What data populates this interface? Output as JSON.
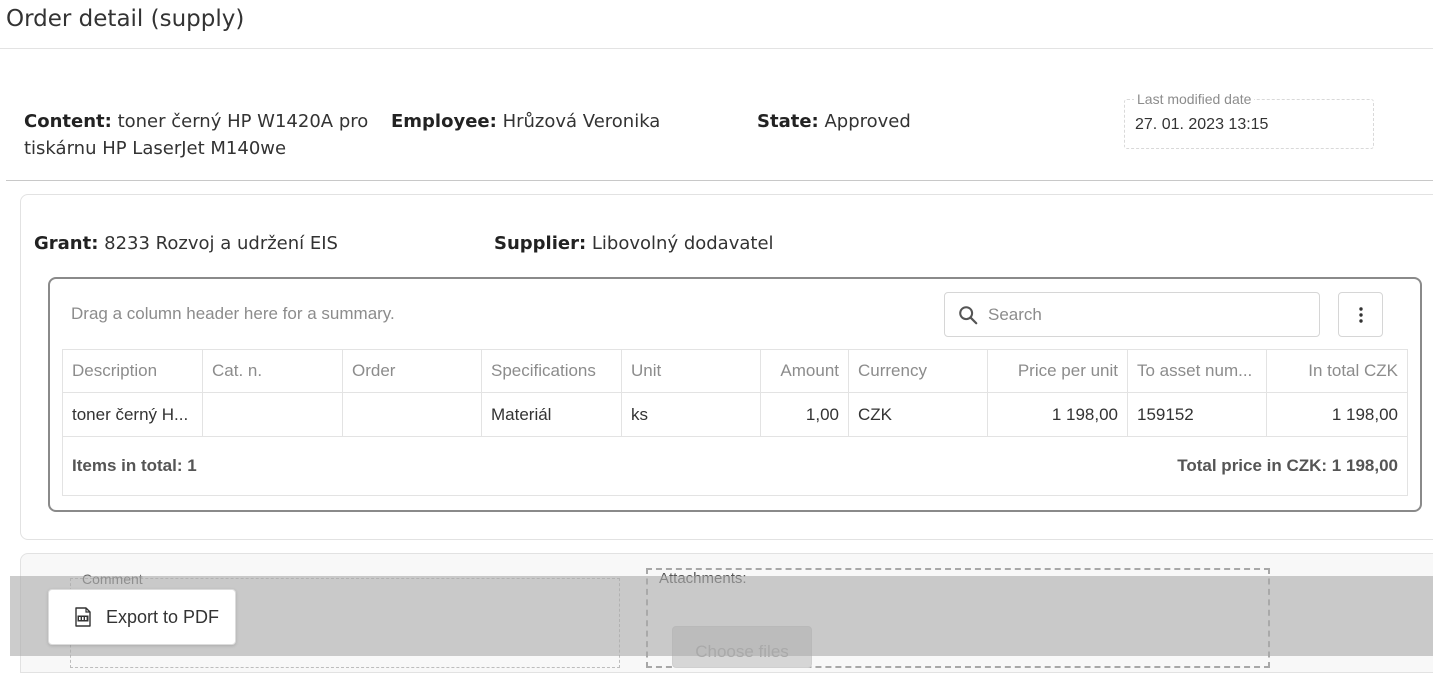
{
  "page": {
    "title": "Order detail (supply)"
  },
  "header": {
    "content_label": "Content:",
    "content_value": "toner černý HP W1420A pro",
    "content_value_2": "tiskárnu HP LaserJet M140we",
    "employee_label": "Employee:",
    "employee_value": "Hrůzová Veronika",
    "state_label": "State:",
    "state_value": "Approved",
    "last_modified_label": "Last modified date",
    "last_modified_value": "27. 01. 2023 13:15"
  },
  "details": {
    "grant_label": "Grant:",
    "grant_value": "8233 Rozvoj a udržení EIS",
    "supplier_label": "Supplier:",
    "supplier_value": "Libovolný dodavatel"
  },
  "grid": {
    "drag_hint": "Drag a column header here for a summary.",
    "search_placeholder": "Search",
    "columns": [
      "Description",
      "Cat. n.",
      "Order",
      "Specifications",
      "Unit",
      "Amount",
      "Currency",
      "Price per unit",
      "To asset num...",
      "In total CZK"
    ],
    "rows": [
      [
        "toner černý H...",
        "",
        "",
        "Materiál",
        "ks",
        "1,00",
        "CZK",
        "1 198,00",
        "159152",
        "1 198,00"
      ]
    ],
    "footer_items": "Items in total: 1",
    "footer_total": "Total price in CZK: 1 198,00"
  },
  "lower": {
    "comment_label": "Comment",
    "attachments_label": "Attachments:",
    "choose_files_label": "Choose files",
    "export_label": "Export to PDF"
  },
  "icons": {
    "search": "search-icon",
    "menu": "vertical-dots-icon",
    "pdf": "pdf-icon"
  }
}
